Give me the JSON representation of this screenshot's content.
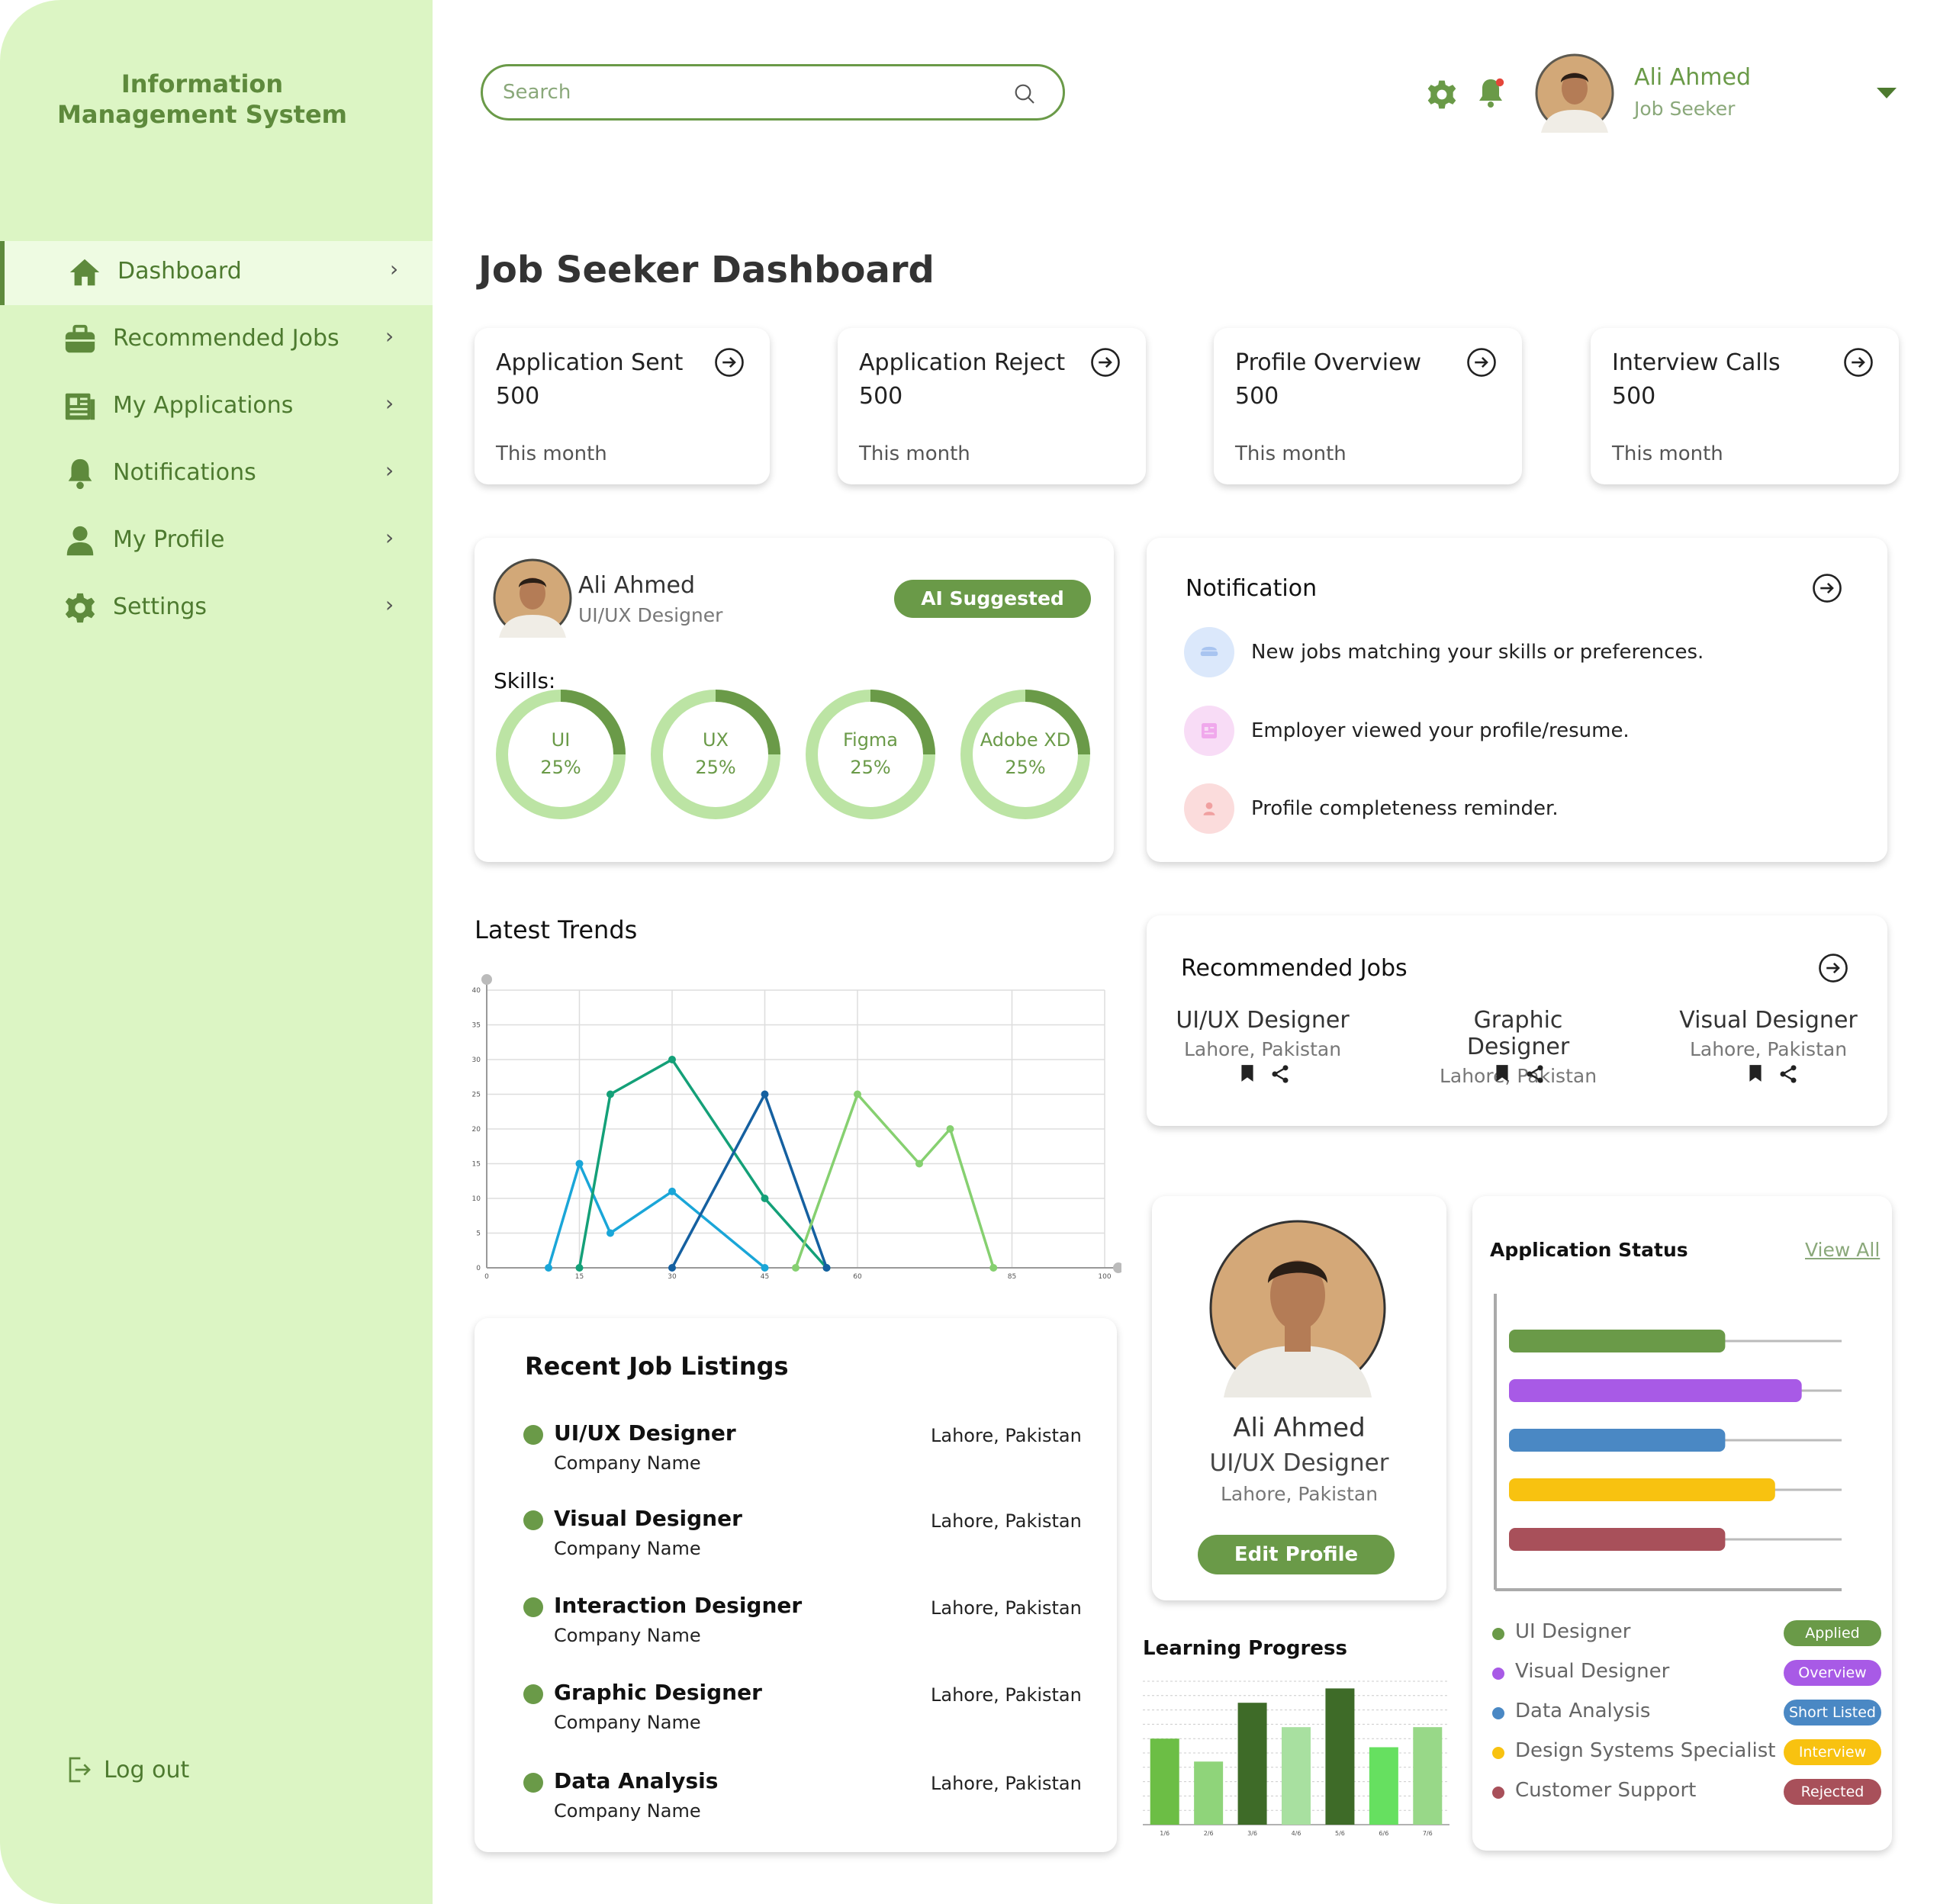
{
  "app": {
    "title": "Information Management System"
  },
  "sidebar": {
    "items": [
      {
        "label": "Dashboard",
        "icon": "home-icon",
        "active": true
      },
      {
        "label": "Recommended Jobs",
        "icon": "briefcase-icon"
      },
      {
        "label": "My Applications",
        "icon": "document-icon"
      },
      {
        "label": "Notifications",
        "icon": "bell-icon"
      },
      {
        "label": "My Profile",
        "icon": "user-icon"
      },
      {
        "label": "Settings",
        "icon": "gear-icon"
      }
    ],
    "logout": "Log out"
  },
  "header": {
    "search_placeholder": "Search",
    "user": {
      "name": "Ali Ahmed",
      "role": "Job Seeker"
    }
  },
  "page": {
    "title": "Job Seeker Dashboard"
  },
  "stats": [
    {
      "title": "Application Sent",
      "value": "500",
      "period": "This month"
    },
    {
      "title": "Application Reject",
      "value": "500",
      "period": "This month"
    },
    {
      "title": "Profile Overview",
      "value": "500",
      "period": "This month"
    },
    {
      "title": "Interview Calls",
      "value": "500",
      "period": "This month"
    }
  ],
  "skills_card": {
    "name": "Ali Ahmed",
    "role": "UI/UX Designer",
    "badge": "AI Suggested",
    "skills_label": "Skills:",
    "skills": [
      {
        "name": "UI",
        "percent": "25%",
        "value": 25
      },
      {
        "name": "UX",
        "percent": "25%",
        "value": 25
      },
      {
        "name": "Figma",
        "percent": "25%",
        "value": 25
      },
      {
        "name": "Adobe XD",
        "percent": "25%",
        "value": 25
      }
    ]
  },
  "notifications": {
    "title": "Notification",
    "items": [
      {
        "text": "New jobs matching your skills or preferences.",
        "icon": "hat-icon",
        "color": "#dbe8fb"
      },
      {
        "text": "Employer viewed your profile/resume.",
        "icon": "resume-icon",
        "color": "#f8dcf6"
      },
      {
        "text": "Profile completeness reminder.",
        "icon": "person-icon",
        "color": "#fbdcdc"
      }
    ]
  },
  "trends": {
    "title": "Latest Trends"
  },
  "chart_data": [
    {
      "type": "line",
      "title": "Latest Trends",
      "xlim": [
        0,
        100
      ],
      "ylim": [
        0,
        40
      ],
      "y_ticks": [
        0,
        5,
        10,
        15,
        20,
        25,
        30,
        35,
        40
      ],
      "x_ticks": [
        "0",
        "15",
        "30",
        "45",
        "60",
        "85",
        "100"
      ],
      "grid": true,
      "series": [
        {
          "color": "#1aa6d8",
          "x": [
            10,
            15,
            20,
            30,
            45
          ],
          "y": [
            0,
            15,
            5,
            11,
            0
          ]
        },
        {
          "color": "#14a078",
          "x": [
            15,
            20,
            30,
            45,
            55
          ],
          "y": [
            0,
            25,
            30,
            10,
            0
          ]
        },
        {
          "color": "#1560a0",
          "x": [
            30,
            45,
            55
          ],
          "y": [
            0,
            25,
            0
          ]
        },
        {
          "color": "#86d070",
          "x": [
            50,
            60,
            70,
            75,
            82
          ],
          "y": [
            0,
            25,
            15,
            20,
            0
          ]
        }
      ]
    },
    {
      "type": "bar",
      "title": "Learning Progress",
      "categories": [
        "1/6",
        "2/6",
        "3/6",
        "4/6",
        "5/6",
        "6/6",
        "7/6"
      ],
      "values": [
        60,
        44,
        85,
        68,
        95,
        54,
        68
      ],
      "colors": [
        "#6cbe45",
        "#8fd47a",
        "#3e6b28",
        "#a8e0a0",
        "#3e6b28",
        "#66e060",
        "#98d888"
      ],
      "ylim": [
        0,
        100
      ]
    },
    {
      "type": "bar",
      "orientation": "horizontal",
      "title": "Application Status",
      "categories": [
        "UI Designer",
        "Visual Designer",
        "Data Analysis",
        "Design Systems Specialist",
        "Customer Support"
      ],
      "values": [
        65,
        88,
        65,
        80,
        65
      ],
      "colors": [
        "#6a9a48",
        "#a85ae6",
        "#4a88c4",
        "#f8c210",
        "#a8505a"
      ],
      "xlim": [
        0,
        100
      ]
    }
  ],
  "recommended": {
    "title": "Recommended Jobs",
    "jobs": [
      {
        "title": "UI/UX Designer",
        "location": "Lahore, Pakistan"
      },
      {
        "title": "Graphic Designer",
        "location": "Lahore, Pakistan"
      },
      {
        "title": "Visual Designer",
        "location": "Lahore, Pakistan"
      }
    ]
  },
  "profile": {
    "name": "Ali Ahmed",
    "role": "UI/UX Designer",
    "location": "Lahore, Pakistan",
    "button": "Edit Profile"
  },
  "learning": {
    "title": "Learning Progress"
  },
  "status": {
    "title": "Application Status",
    "view_all": "View All",
    "items": [
      {
        "name": "UI Designer",
        "status": "Applied",
        "color": "#6a9a48"
      },
      {
        "name": "Visual Designer",
        "status": "Overview",
        "color": "#a85ae6"
      },
      {
        "name": "Data Analysis",
        "status": "Short Listed",
        "color": "#4a88c4"
      },
      {
        "name": "Design Systems Specialist",
        "status": "Interview",
        "color": "#f8c210"
      },
      {
        "name": "Customer Support",
        "status": "Rejected",
        "color": "#a8505a"
      }
    ]
  },
  "listings": {
    "title": "Recent Job Listings",
    "items": [
      {
        "title": "UI/UX Designer",
        "company": "Company Name",
        "location": "Lahore, Pakistan"
      },
      {
        "title": "Visual Designer",
        "company": "Company Name",
        "location": "Lahore, Pakistan"
      },
      {
        "title": "Interaction Designer",
        "company": "Company Name",
        "location": "Lahore, Pakistan"
      },
      {
        "title": "Graphic Designer",
        "company": "Company Name",
        "location": "Lahore, Pakistan"
      },
      {
        "title": "Data Analysis",
        "company": "Company Name",
        "location": "Lahore, Pakistan"
      }
    ]
  },
  "colors": {
    "primary": "#6a9a48",
    "sidebar": "#dcf5c4",
    "accent_text": "#4d7a2f"
  }
}
